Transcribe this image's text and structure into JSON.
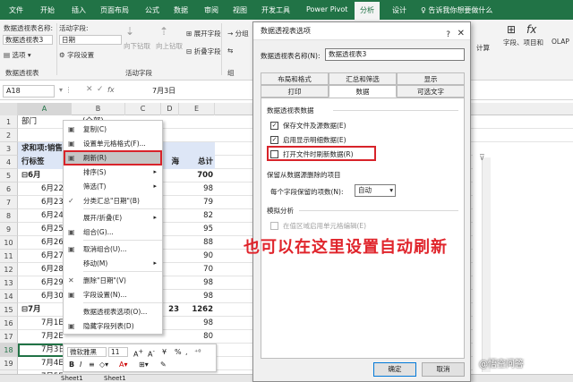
{
  "ribbon_tabs": [
    "文件",
    "开始",
    "插入",
    "页面布局",
    "公式",
    "数据",
    "审阅",
    "视图",
    "开发工具",
    "Power Pivot",
    "分析",
    "设计"
  ],
  "active_tab": "分析",
  "tell_me": "告诉我你想要做什么",
  "ribbon": {
    "pivot_name_label": "数据透视表名称:",
    "pivot_name_value": "数据透视表3",
    "options_label": "选项",
    "group_pivot": "数据透视表",
    "active_field_label": "活动字段:",
    "active_field_value": "日期",
    "field_settings_label": "字段设置",
    "drill_down": "向下钻取",
    "drill_up": "向上钻取",
    "expand_field": "展开字段",
    "collapse_field": "折叠字段",
    "group_active_field": "活动字段",
    "group_selection": "分组",
    "group_right_label": "计算",
    "fields_items": "字段、项目和",
    "olap": "OLAP"
  },
  "formula_bar": {
    "name_box": "A18",
    "fx": "fx",
    "value": "7月3日"
  },
  "columns": [
    "A",
    "B",
    "C",
    "D",
    "E"
  ],
  "rows": [
    {
      "n": "1",
      "a": "部门",
      "b": "(全部)",
      "d": "",
      "e": ""
    },
    {
      "n": "2",
      "a": "",
      "b": "",
      "d": "",
      "e": ""
    },
    {
      "n": "3",
      "a": "求和项:销售",
      "b": "",
      "d": "",
      "e": ""
    },
    {
      "n": "4",
      "a": "行标签",
      "b": "",
      "d": "海",
      "e": "总计"
    },
    {
      "n": "5",
      "a": "⊟6月",
      "b": "",
      "d": "",
      "e": "700"
    },
    {
      "n": "6",
      "a": "6月22",
      "b": "",
      "d": "",
      "e": "98"
    },
    {
      "n": "7",
      "a": "6月23",
      "b": "",
      "d": "",
      "e": "79"
    },
    {
      "n": "8",
      "a": "6月24",
      "b": "",
      "d": "",
      "e": "82"
    },
    {
      "n": "9",
      "a": "6月25",
      "b": "",
      "d": "",
      "e": "95"
    },
    {
      "n": "10",
      "a": "6月26",
      "b": "",
      "d": "",
      "e": "88"
    },
    {
      "n": "11",
      "a": "6月27",
      "b": "",
      "d": "",
      "e": "90"
    },
    {
      "n": "12",
      "a": "6月28",
      "b": "",
      "d": "",
      "e": "70"
    },
    {
      "n": "13",
      "a": "6月29",
      "b": "",
      "d": "",
      "e": "98"
    },
    {
      "n": "14",
      "a": "6月30",
      "b": "",
      "d": "",
      "e": "98"
    },
    {
      "n": "15",
      "a": "⊟7月",
      "b": "",
      "d": "23",
      "e": "1262"
    },
    {
      "n": "16",
      "a": "7月1E",
      "b": "",
      "d": "",
      "e": "98"
    },
    {
      "n": "17",
      "a": "7月2E",
      "b": "",
      "d": "",
      "e": "80"
    },
    {
      "n": "18",
      "a": "7月3日",
      "b": "",
      "d": "90",
      "e": "90"
    },
    {
      "n": "19",
      "a": "7月4E",
      "b": "",
      "d": "",
      "e": ""
    },
    {
      "n": "20",
      "a": "7月5E",
      "b": "",
      "d": "",
      "e": ""
    },
    {
      "n": "21",
      "a": "7月6E",
      "b": "",
      "d": "",
      "e": ""
    }
  ],
  "context_menu": [
    {
      "label": "复制(C)",
      "disabled": false,
      "arrow": false,
      "icon": "copy-icon"
    },
    {
      "label": "设置单元格格式(F)...",
      "disabled": false,
      "arrow": false,
      "icon": "format-cells-icon"
    },
    {
      "label": "刷新(R)",
      "disabled": false,
      "arrow": false,
      "icon": "refresh-icon",
      "highlight": true
    },
    {
      "label": "排序(S)",
      "disabled": false,
      "arrow": true
    },
    {
      "label": "筛选(T)",
      "disabled": false,
      "arrow": true
    },
    {
      "label": "分类汇总\"日期\"(B)",
      "disabled": false,
      "arrow": false,
      "icon": "check-icon"
    },
    {
      "label": "展开/折叠(E)",
      "disabled": false,
      "arrow": true
    },
    {
      "label": "组合(G)...",
      "disabled": false,
      "arrow": false,
      "icon": "group-icon"
    },
    {
      "label": "取消组合(U)...",
      "disabled": false,
      "arrow": false,
      "icon": "ungroup-icon"
    },
    {
      "label": "移动(M)",
      "disabled": false,
      "arrow": true
    },
    {
      "label": "删除\"日期\"(V)",
      "disabled": false,
      "arrow": false,
      "icon": "delete-icon"
    },
    {
      "label": "字段设置(N)...",
      "disabled": false,
      "arrow": false,
      "icon": "field-settings-icon"
    },
    {
      "label": "数据透视表选项(O)...",
      "disabled": false,
      "arrow": false
    },
    {
      "label": "隐藏字段列表(D)",
      "disabled": false,
      "arrow": false,
      "icon": "field-list-icon"
    }
  ],
  "mini_toolbar": {
    "font": "微软雅黑",
    "size": "11",
    "currency": "¥",
    "percent": "%"
  },
  "sheet_tabs": [
    "Sheet1",
    "Sheet1"
  ],
  "dialog": {
    "title": "数据透视表选项",
    "help": "?",
    "close": "✕",
    "name_label": "数据透视表名称(N):",
    "name_value": "数据透视表3",
    "tabs_row1": [
      "布局和格式",
      "汇总和筛选",
      "显示"
    ],
    "tabs_row2": [
      "打印",
      "数据",
      "可选文字"
    ],
    "active_tab": "数据",
    "section_data": "数据透视表数据",
    "cb_save": "保存文件及源数据(E)",
    "cb_detail": "启用显示明细数据(E)",
    "cb_refresh": "打开文件时刷新数据(R)",
    "section_retain": "保留从数据源删除的项目",
    "retain_label": "每个字段保留的项数(N):",
    "retain_value": "自动",
    "section_whatif": "模拟分析",
    "cb_whatif": "在值区域启用单元格编辑(E)",
    "ok": "确定",
    "cancel": "取消"
  },
  "annotation": "也可以在这里设置自动刷新",
  "watermark": "@悟空问答",
  "colors": {
    "excel_green": "#217346",
    "highlight_red": "#d8232a",
    "annotation_red": "#e0252c"
  }
}
